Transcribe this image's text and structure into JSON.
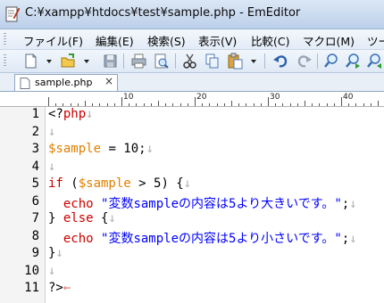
{
  "window": {
    "title": "C:¥xampp¥htdocs¥test¥sample.php - EmEditor",
    "app_icon": "emeditor-icon"
  },
  "menu": {
    "items": [
      {
        "label": "ファイル(F)"
      },
      {
        "label": "編集(E)"
      },
      {
        "label": "検索(S)"
      },
      {
        "label": "表示(V)"
      },
      {
        "label": "比較(C)"
      },
      {
        "label": "マクロ(M)"
      },
      {
        "label": "ツー"
      }
    ]
  },
  "toolbar": {
    "buttons": [
      {
        "name": "new-file-icon"
      },
      {
        "name": "open-folder-icon"
      },
      {
        "name": "save-icon"
      },
      {
        "name": "print-icon"
      },
      {
        "name": "print-preview-icon"
      },
      {
        "name": "cut-icon"
      },
      {
        "name": "copy-icon"
      },
      {
        "name": "paste-icon"
      },
      {
        "name": "undo-icon"
      },
      {
        "name": "redo-icon"
      },
      {
        "name": "find-icon"
      },
      {
        "name": "find-next-icon"
      },
      {
        "name": "find-previous-icon"
      }
    ]
  },
  "tabs": [
    {
      "label": "sample.php",
      "close": "×"
    }
  ],
  "ruler": {
    "marks": [
      "10",
      "20",
      "30",
      "40"
    ]
  },
  "editor": {
    "line_numbers": [
      "1",
      "2",
      "3",
      "4",
      "5",
      "6",
      "7",
      "8",
      "9",
      "10",
      "11"
    ],
    "lines": [
      {
        "parts": [
          {
            "t": "<?",
            "c": "plain"
          },
          {
            "t": "php",
            "c": "kw2"
          },
          {
            "t": "↓",
            "c": "ret"
          }
        ]
      },
      {
        "parts": [
          {
            "t": "↓",
            "c": "ret"
          }
        ]
      },
      {
        "parts": [
          {
            "t": "$sample",
            "c": "var"
          },
          {
            "t": " = 10;",
            "c": "plain"
          },
          {
            "t": "↓",
            "c": "ret"
          }
        ]
      },
      {
        "parts": [
          {
            "t": "↓",
            "c": "ret"
          }
        ]
      },
      {
        "parts": [
          {
            "t": "if",
            "c": "kw2"
          },
          {
            "t": " (",
            "c": "plain"
          },
          {
            "t": "$sample",
            "c": "var"
          },
          {
            "t": " > 5) {",
            "c": "plain"
          },
          {
            "t": "↓",
            "c": "ret"
          }
        ]
      },
      {
        "parts": [
          {
            "t": "  ",
            "c": "plain"
          },
          {
            "t": "echo",
            "c": "kw2"
          },
          {
            "t": " ",
            "c": "plain"
          },
          {
            "t": "\"変数sampleの内容は5より大きいです。\"",
            "c": "str"
          },
          {
            "t": ";",
            "c": "plain"
          },
          {
            "t": "↓",
            "c": "ret"
          }
        ]
      },
      {
        "parts": [
          {
            "t": "} ",
            "c": "plain"
          },
          {
            "t": "else",
            "c": "kw2"
          },
          {
            "t": " {",
            "c": "plain"
          },
          {
            "t": "↓",
            "c": "ret"
          }
        ]
      },
      {
        "parts": [
          {
            "t": "  ",
            "c": "plain"
          },
          {
            "t": "echo",
            "c": "kw2"
          },
          {
            "t": " ",
            "c": "plain"
          },
          {
            "t": "\"変数sampleの内容は5より小さいです。\"",
            "c": "str"
          },
          {
            "t": ";",
            "c": "plain"
          },
          {
            "t": "↓",
            "c": "ret"
          }
        ]
      },
      {
        "parts": [
          {
            "t": "}",
            "c": "plain"
          },
          {
            "t": "↓",
            "c": "ret"
          }
        ]
      },
      {
        "parts": [
          {
            "t": "↓",
            "c": "ret"
          }
        ]
      },
      {
        "parts": [
          {
            "t": "?>",
            "c": "plain"
          },
          {
            "t": "←",
            "c": "ret-last"
          }
        ]
      }
    ]
  },
  "colors": {
    "keyword": "#cc0000",
    "variable": "#e08000",
    "string": "#0000ff",
    "return_mark": "#b0b0b0"
  }
}
